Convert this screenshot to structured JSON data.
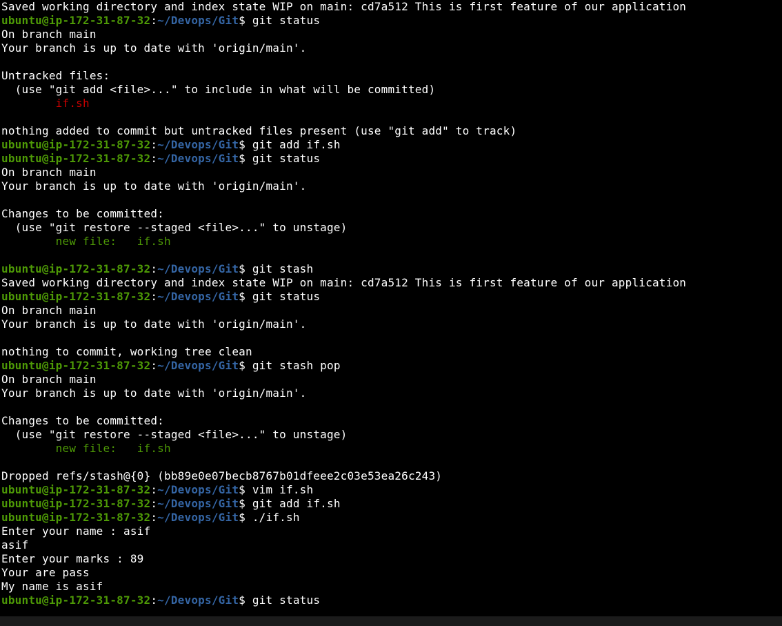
{
  "prompt": {
    "user_host": "ubuntu@ip-172-31-87-32",
    "sep1": ":",
    "path": "~/Devops/Git",
    "dollar": "$ "
  },
  "commands": {
    "git_status": "git status",
    "git_add_if": "git add if.sh",
    "git_stash": "git stash",
    "git_stash_pop": "git stash pop",
    "vim_if": "vim if.sh",
    "run_if": "./if.sh"
  },
  "lines": {
    "saved_wip": "Saved working directory and index state WIP on main: cd7a512 This is first feature of our application",
    "on_branch": "On branch main",
    "uptodate": "Your branch is up to date with 'origin/main'.",
    "blank": "",
    "untracked_header": "Untracked files:",
    "untracked_hint": "  (use \"git add <file>...\" to include in what will be committed)",
    "untracked_file_indent": "        ",
    "untracked_file": "if.sh",
    "nothing_added": "nothing added to commit but untracked files present (use \"git add\" to track)",
    "changes_header": "Changes to be committed:",
    "restore_hint": "  (use \"git restore --staged <file>...\" to unstage)",
    "newfile_indent": "        ",
    "newfile_label": "new file:   if.sh",
    "nothing_to_commit": "nothing to commit, working tree clean",
    "dropped": "Dropped refs/stash@{0} (bb89e0e07becb8767b01dfeee2c03e53ea26c243)",
    "enter_name": "Enter your name : asif",
    "echo_name": "asif",
    "enter_marks": "Enter your marks : 89",
    "pass": "Your are pass",
    "myname": "My name is asif"
  }
}
